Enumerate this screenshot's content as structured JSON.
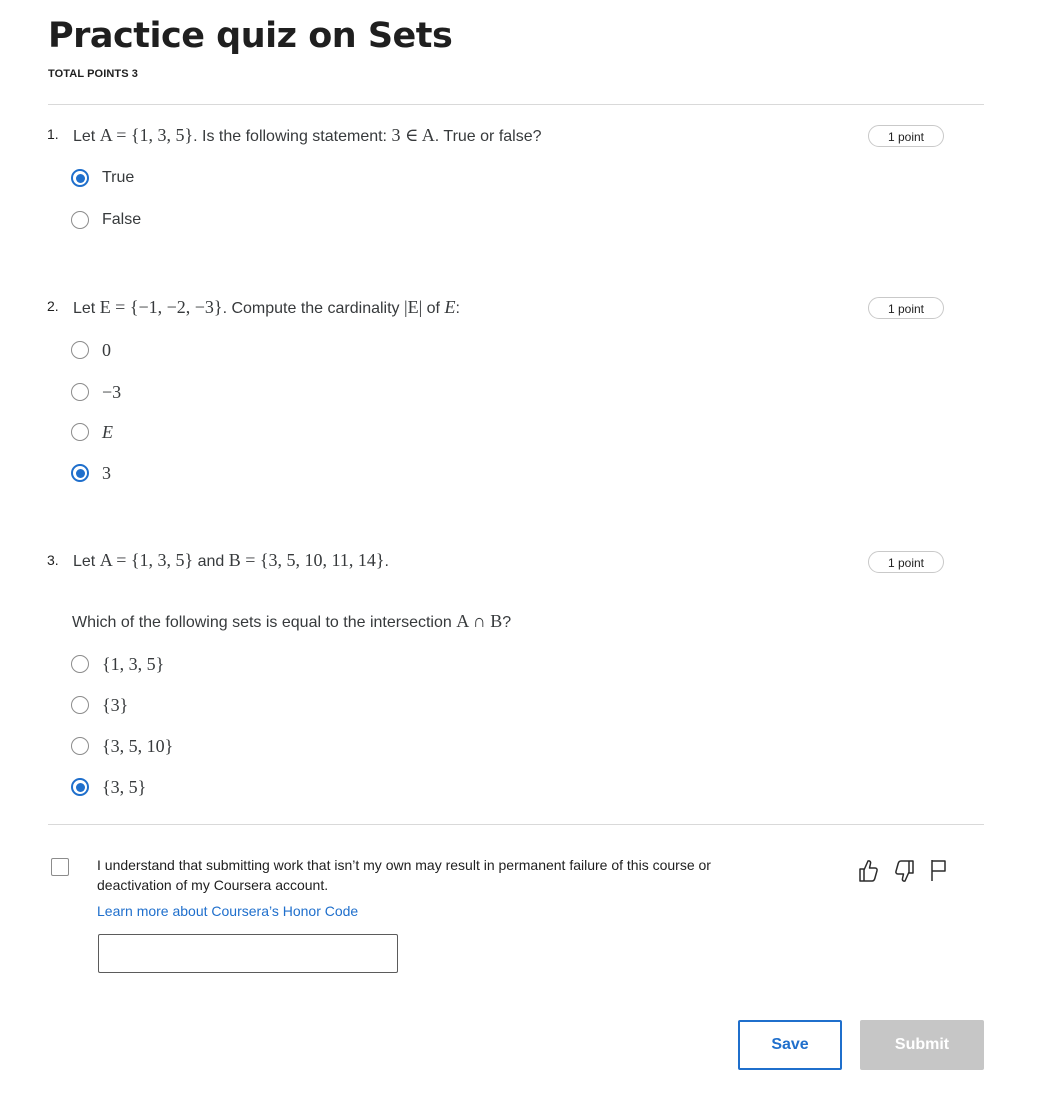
{
  "quiz": {
    "title": "Practice quiz on Sets",
    "total_points": "TOTAL POINTS 3"
  },
  "questions": [
    {
      "number": "1.",
      "points": "1 point",
      "prompt_parts": [
        "Let ",
        "A = {1, 3, 5}",
        ". Is the following statement: ",
        "3 ∈ A",
        ". True or false?"
      ],
      "options": [
        {
          "label": "True",
          "selected": true
        },
        {
          "label": "False",
          "selected": false
        }
      ]
    },
    {
      "number": "2.",
      "points": "1 point",
      "prompt_parts": [
        "Let ",
        "E = {−1, −2, −3}",
        ". Compute the cardinality ",
        "|E|",
        " of ",
        "E",
        ":"
      ],
      "options": [
        {
          "label": "0",
          "selected": false
        },
        {
          "label": "−3",
          "selected": false
        },
        {
          "label": "E",
          "selected": false
        },
        {
          "label": "3",
          "selected": true
        }
      ]
    },
    {
      "number": "3.",
      "points": "1 point",
      "prompt_parts": [
        "Let ",
        "A = {1, 3, 5}",
        " and ",
        "B = {3, 5, 10, 11, 14}",
        "."
      ],
      "subprompt_parts": [
        "Which of the following sets is equal to the intersection ",
        "A ∩ B",
        "?"
      ],
      "options": [
        {
          "label": "{1, 3, 5}",
          "selected": false
        },
        {
          "label": "{3}",
          "selected": false
        },
        {
          "label": "{3, 5, 10}",
          "selected": false
        },
        {
          "label": "{3, 5}",
          "selected": true
        }
      ]
    }
  ],
  "honor_code": {
    "checked": false,
    "text": "I understand that submitting work that isn’t my own may result in permanent failure of this course or deactivation of my Coursera account.",
    "link": "Learn more about Coursera’s Honor Code",
    "name_value": "",
    "name_placeholder": ""
  },
  "icons": {
    "like": "thumbs-up-icon",
    "dislike": "thumbs-down-icon",
    "flag": "flag-icon"
  },
  "buttons": {
    "save": "Save",
    "submit": "Submit"
  },
  "colors": {
    "accent": "#1f6fcc",
    "submit_disabled": "#c6c6c6",
    "divider": "#d9d9d9"
  }
}
